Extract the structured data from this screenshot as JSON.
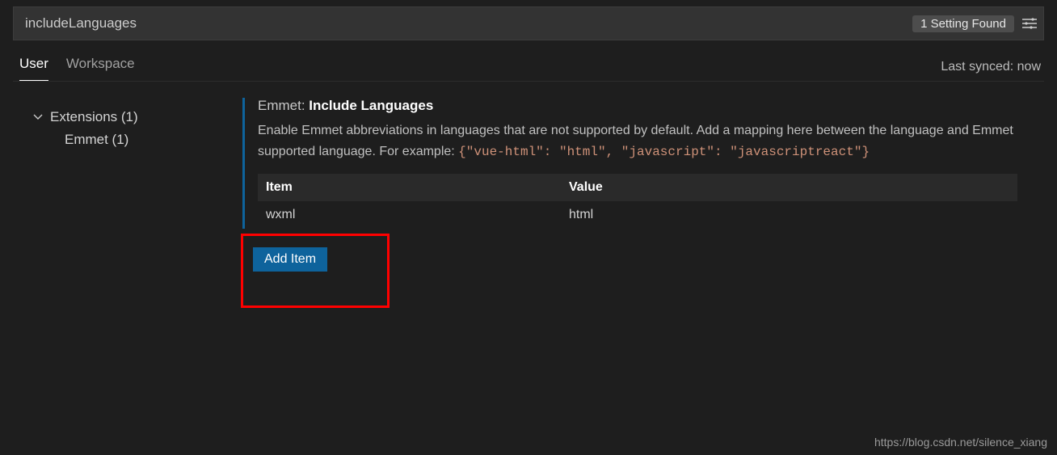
{
  "search": {
    "value": "includeLanguages",
    "found_badge": "1 Setting Found"
  },
  "tabs": {
    "user": "User",
    "workspace": "Workspace"
  },
  "sync_status": "Last synced: now",
  "tree": {
    "extensions_label": "Extensions (1)",
    "emmet_label": "Emmet (1)"
  },
  "setting": {
    "prefix": "Emmet:",
    "name": "Include Languages",
    "desc1": "Enable Emmet abbreviations in languages that are not supported by default. Add a mapping here between the language and Emmet supported language. For example: ",
    "code": "{\"vue-html\": \"html\", \"javascript\": \"javascriptreact\"}",
    "table": {
      "header_item": "Item",
      "header_value": "Value",
      "rows": [
        {
          "item": "wxml",
          "value": "html"
        }
      ]
    },
    "add_button": "Add Item"
  },
  "watermark": "https://blog.csdn.net/silence_xiang"
}
